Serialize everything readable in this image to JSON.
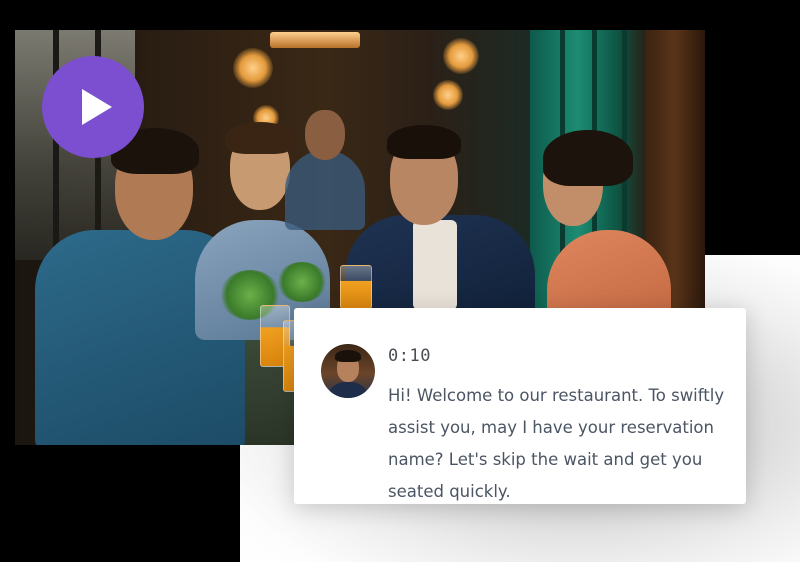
{
  "video": {
    "play_icon": "play-icon",
    "accent_color": "#7b4fd0"
  },
  "transcript": {
    "timestamp": "0:10",
    "message": "Hi! Welcome to our restaurant. To swiftly assist you, may I have your reservation name? Let's skip the wait and get you seated quickly."
  }
}
